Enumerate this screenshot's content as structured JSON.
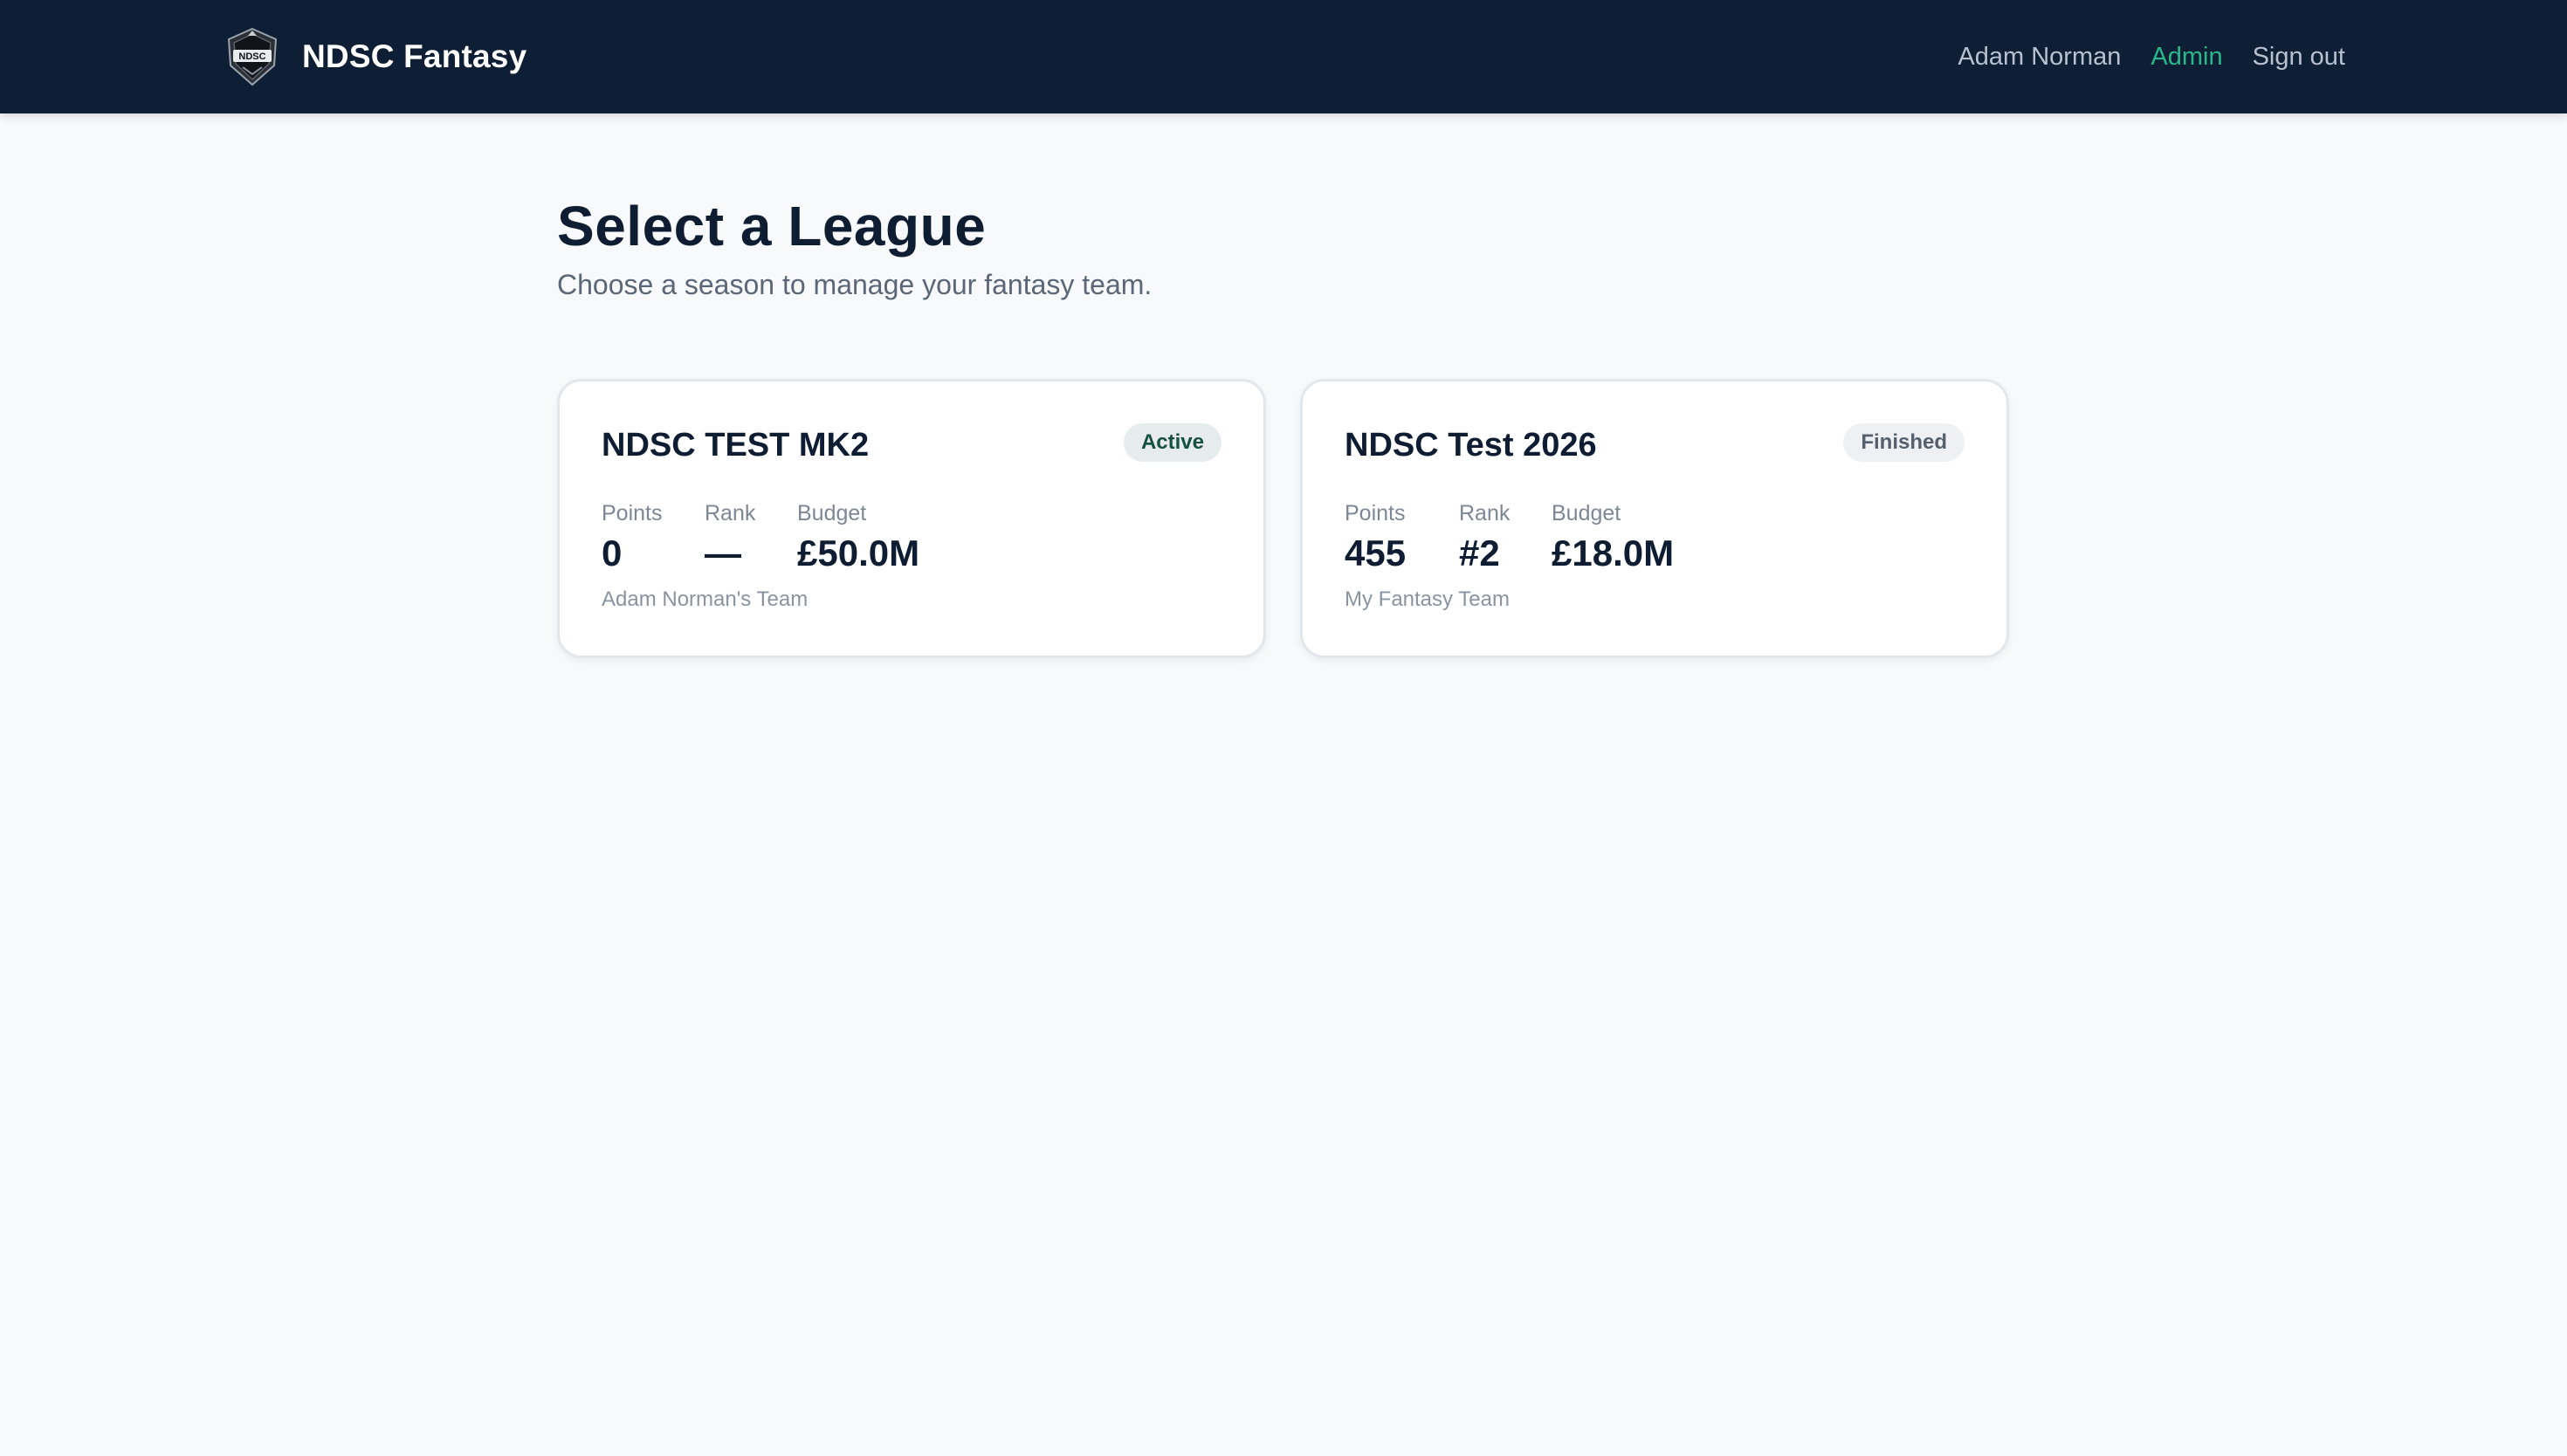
{
  "header": {
    "brand": "NDSC Fantasy",
    "logo_text": "NDSC",
    "user_name": "Adam Norman",
    "admin_label": "Admin",
    "signout_label": "Sign out"
  },
  "page": {
    "title": "Select a League",
    "subtitle": "Choose a season to manage your fantasy team."
  },
  "leagues": [
    {
      "name": "NDSC TEST MK2",
      "status": "Active",
      "points_label": "Points",
      "points": "0",
      "rank_label": "Rank",
      "rank": "—",
      "budget_label": "Budget",
      "budget": "£50.0M",
      "team_name": "Adam Norman's Team"
    },
    {
      "name": "NDSC Test 2026",
      "status": "Finished",
      "points_label": "Points",
      "points": "455",
      "rank_label": "Rank",
      "rank": "#2",
      "budget_label": "Budget",
      "budget": "£18.0M",
      "team_name": "My Fantasy Team"
    }
  ],
  "colors": {
    "header_bg": "#0d1e35",
    "accent": "#2bb78a",
    "page_bg": "#f7f9fb",
    "text_dark": "#0f1d33"
  }
}
